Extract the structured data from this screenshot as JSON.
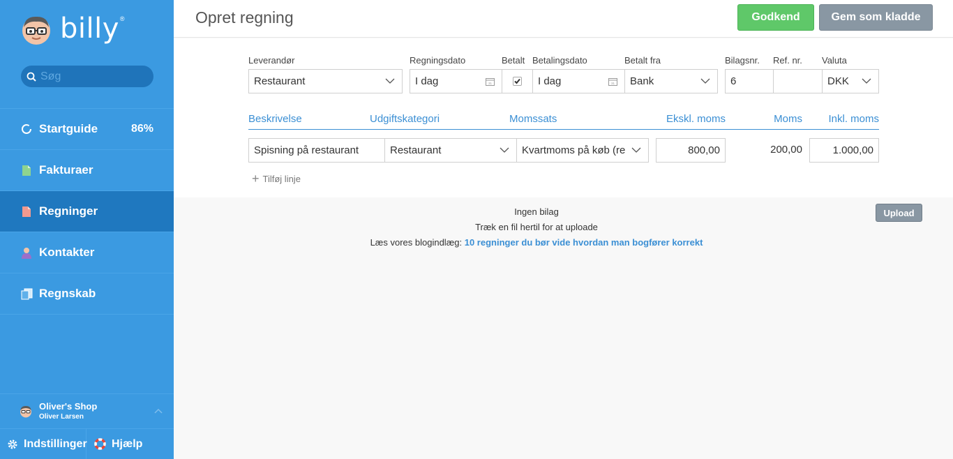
{
  "app": {
    "logo_text": "billy",
    "logo_mark": "®"
  },
  "search": {
    "placeholder": "Søg"
  },
  "sidebar": {
    "items": [
      {
        "label": "Startguide",
        "icon": "progress-ring-icon",
        "badge": "86%",
        "active": false
      },
      {
        "label": "Fakturaer",
        "icon": "invoice-document-icon",
        "active": false
      },
      {
        "label": "Regninger",
        "icon": "bill-document-icon",
        "active": true
      },
      {
        "label": "Kontakter",
        "icon": "person-icon",
        "active": false
      },
      {
        "label": "Regnskab",
        "icon": "ledger-icon",
        "active": false
      }
    ],
    "account": {
      "shop": "Oliver's Shop",
      "user": "Oliver Larsen"
    },
    "settings_label": "Indstillinger",
    "help_label": "Hjælp"
  },
  "header": {
    "title": "Opret regning",
    "approve_label": "Godkend",
    "draft_label": "Gem som kladde"
  },
  "bill": {
    "labels": {
      "supplier": "Leverandør",
      "bill_date": "Regningsdato",
      "paid": "Betalt",
      "payment_date": "Betalingsdato",
      "paid_from": "Betalt fra",
      "voucher_no": "Bilagsnr.",
      "ref_no": "Ref. nr.",
      "currency": "Valuta"
    },
    "values": {
      "supplier": "Restaurant",
      "bill_date": "I dag",
      "paid": true,
      "payment_date": "I dag",
      "paid_from": "Bank",
      "voucher_no": "6",
      "ref_no": "",
      "currency": "DKK"
    }
  },
  "lines": {
    "headers": {
      "description": "Beskrivelse",
      "category": "Udgiftskategori",
      "vat_rate": "Momssats",
      "excl": "Ekskl. moms",
      "vat": "Moms",
      "incl": "Inkl. moms"
    },
    "rows": [
      {
        "description": "Spisning på restaurant",
        "category": "Restaurant",
        "vat_rate": "Kvartmoms på køb (re",
        "excl": "800,00",
        "vat": "200,00",
        "incl": "1.000,00"
      }
    ],
    "add_line_label": "Tilføj linje"
  },
  "attachments": {
    "empty_label": "Ingen bilag",
    "drop_hint": "Træk en fil hertil for at uploade",
    "blog_prefix": "Læs vores blogindlæg:",
    "blog_link": "10 regninger du bør vide hvordan man bogfører korrekt",
    "upload_label": "Upload"
  },
  "colors": {
    "sidebar": "#3b9ae1",
    "sidebar_active": "#1f78bf",
    "accent": "#3b8fd4",
    "approve": "#5fc869",
    "draft": "#8997a3"
  }
}
